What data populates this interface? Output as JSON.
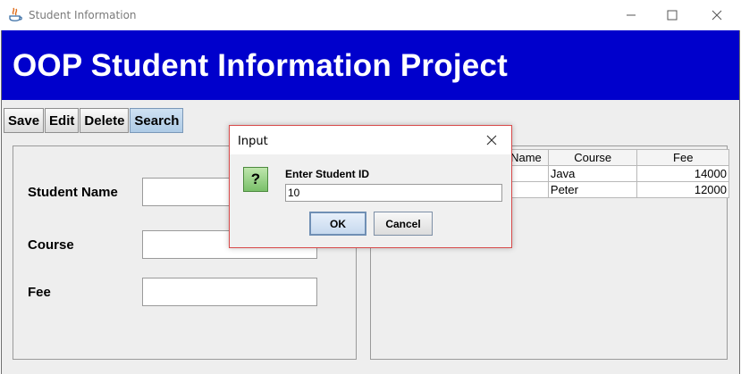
{
  "window": {
    "title": "Student Information"
  },
  "banner": {
    "title": "OOP Student Information Project",
    "background": "#0000cc"
  },
  "toolbar": {
    "buttons": [
      "Save",
      "Edit",
      "Delete",
      "Search"
    ],
    "active": "Search"
  },
  "form": {
    "student_name_label": "Student Name",
    "course_label": "Course",
    "fee_label": "Fee",
    "student_name_value": "",
    "course_value": "",
    "fee_value": ""
  },
  "table": {
    "columns": [
      "Name",
      "Course",
      "Fee"
    ],
    "rows": [
      {
        "name": "",
        "course": "Java",
        "fee": "14000"
      },
      {
        "name": "",
        "course": "Peter",
        "fee": "12000"
      }
    ]
  },
  "dialog": {
    "title": "Input",
    "icon": "question-icon",
    "prompt": "Enter Student ID",
    "value": "10",
    "ok_label": "OK",
    "cancel_label": "Cancel",
    "border_color": "#d84a4a"
  }
}
